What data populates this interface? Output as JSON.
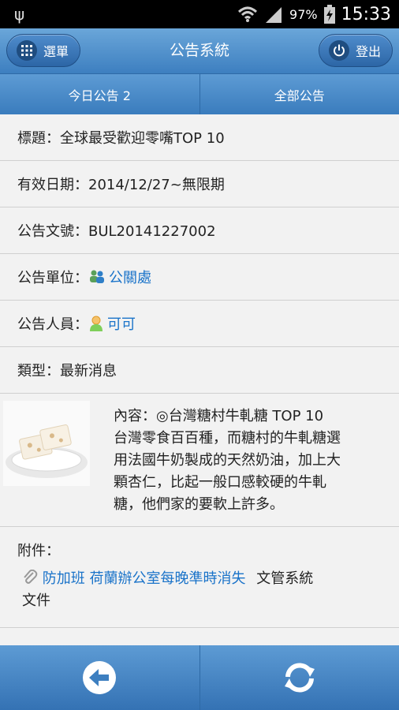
{
  "status_bar": {
    "battery": "97%",
    "time": "15:33"
  },
  "header": {
    "title": "公告系統",
    "menu_label": "選單",
    "logout_label": "登出"
  },
  "tabs": [
    {
      "label": "今日公告  2"
    },
    {
      "label": "全部公告"
    }
  ],
  "fields": {
    "title": "標題：全球最受歡迎零嘴TOP 10",
    "valid_date": "有效日期：2014/12/27~無限期",
    "doc_no": "公告文號：BUL20141227002",
    "unit_label": "公告單位：",
    "unit_value": "公關處",
    "person_label": "公告人員：",
    "person_value": "可可",
    "type": "類型：最新消息"
  },
  "content": {
    "line1": "內容：◎台灣糖村牛軋糖 TOP 10",
    "line2": "台灣零食百百種，而糖村的牛軋糖選",
    "line3": "用法國牛奶製成的天然奶油，加上大",
    "line4": "顆杏仁，比起一般口感較硬的牛軋",
    "line5": "糖，他們家的要軟上許多。"
  },
  "attachment": {
    "label": "附件：",
    "link": "防加班 荷蘭辦公室每晚準時消失",
    "suffix": "文管系統",
    "suffix2": "文件"
  },
  "icons": [
    "usb-icon",
    "wifi-icon",
    "signal-icon",
    "battery-icon",
    "grid-icon",
    "power-icon",
    "group-icon",
    "person-icon",
    "paperclip-icon",
    "back-arrow-icon",
    "refresh-icon"
  ],
  "colors": {
    "accent": "#3d7fc0",
    "link": "#1a73c9"
  }
}
